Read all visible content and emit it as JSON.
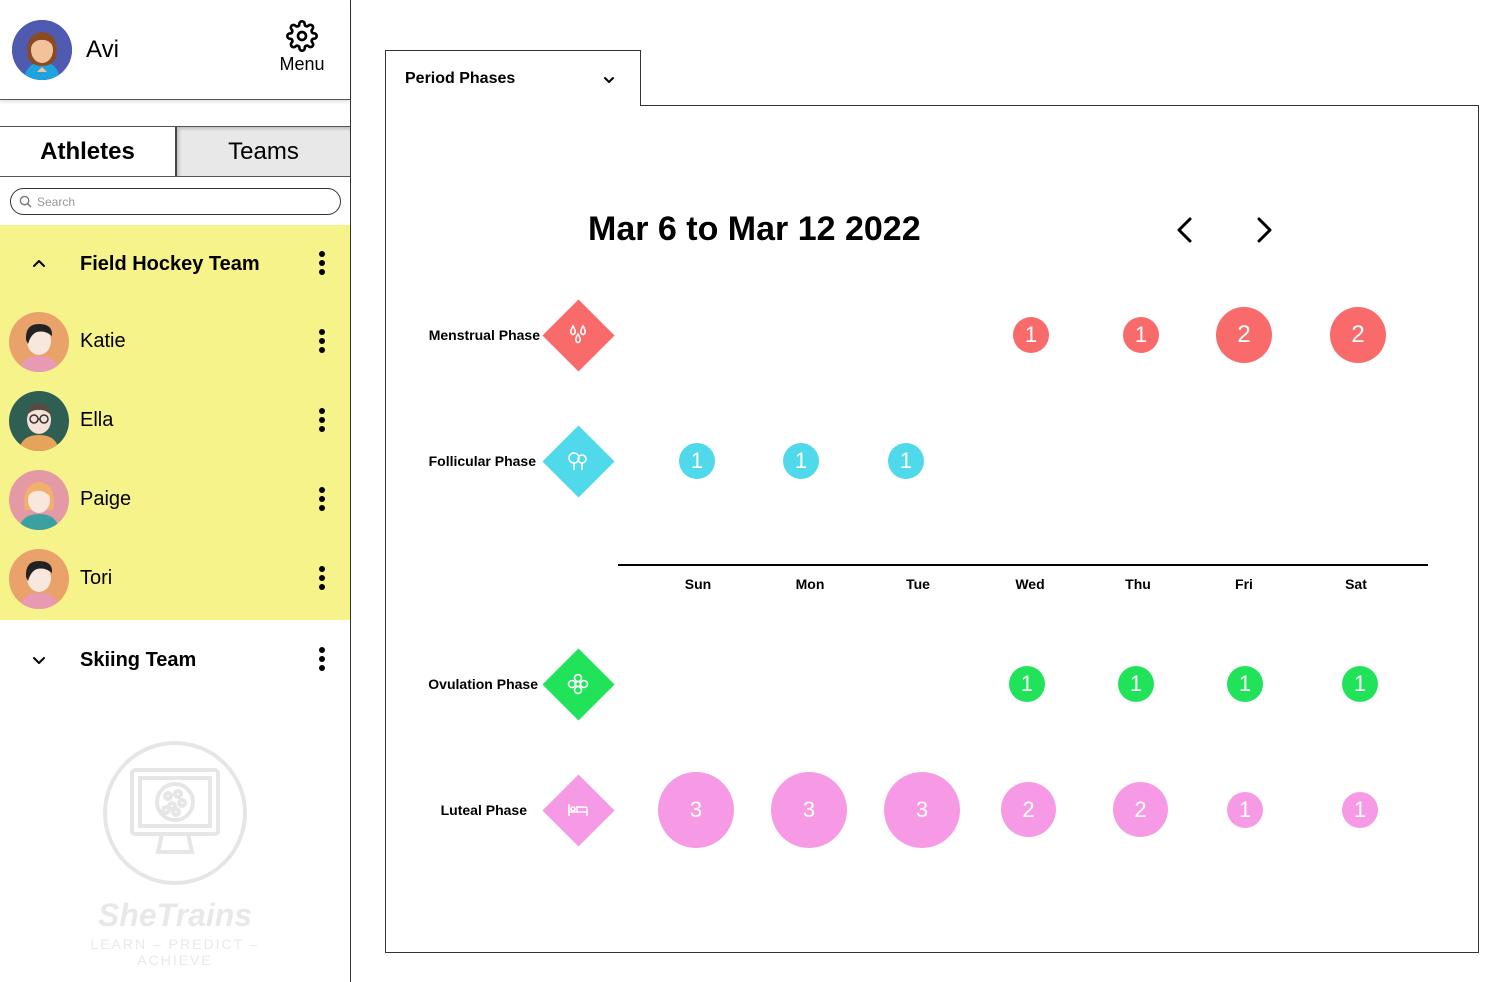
{
  "user": {
    "name": "Avi",
    "menu_label": "Menu"
  },
  "tabs": {
    "athletes": "Athletes",
    "teams": "Teams"
  },
  "search": {
    "placeholder": "Search",
    "value": ""
  },
  "teams": [
    {
      "name": "Field Hockey Team",
      "expanded": true,
      "athletes": [
        "Katie",
        "Ella",
        "Paige",
        "Tori"
      ]
    },
    {
      "name": "Skiing Team",
      "expanded": false,
      "athletes": []
    }
  ],
  "watermark": {
    "brand": "SheTrains",
    "tagline": "LEARN – PREDICT – ACHIEVE"
  },
  "view_selector": {
    "selected": "Period Phases"
  },
  "calendar": {
    "range_title": "Mar 6 to Mar 12 2022",
    "days": [
      "Sun",
      "Mon",
      "Tue",
      "Wed",
      "Thu",
      "Fri",
      "Sat"
    ]
  },
  "phases": {
    "menstrual": {
      "label": "Menstrual Phase",
      "color": "#f96b6b",
      "icon": "drops-icon",
      "counts": {
        "Wed": "1",
        "Thu": "1",
        "Fri": "2",
        "Sat": "2"
      }
    },
    "follicular": {
      "label": "Follicular Phase",
      "color": "#4fd9ea",
      "icon": "trees-icon",
      "counts": {
        "Sun": "1",
        "Mon": "1",
        "Tue": "1"
      }
    },
    "ovulation": {
      "label": "Ovulation Phase",
      "color": "#20e35a",
      "icon": "flower-icon",
      "counts": {
        "Wed": "1",
        "Thu": "1",
        "Fri": "1",
        "Sat": "1"
      }
    },
    "luteal": {
      "label": "Luteal Phase",
      "color": "#f79ae6",
      "icon": "bed-icon",
      "counts": {
        "Sun": "3",
        "Mon": "3",
        "Tue": "3",
        "Wed": "2",
        "Thu": "2",
        "Fri": "1",
        "Sat": "1"
      }
    }
  },
  "colors": {
    "team_highlight": "#f7f38b",
    "avatar_bg_user": "#4f5ab1"
  }
}
